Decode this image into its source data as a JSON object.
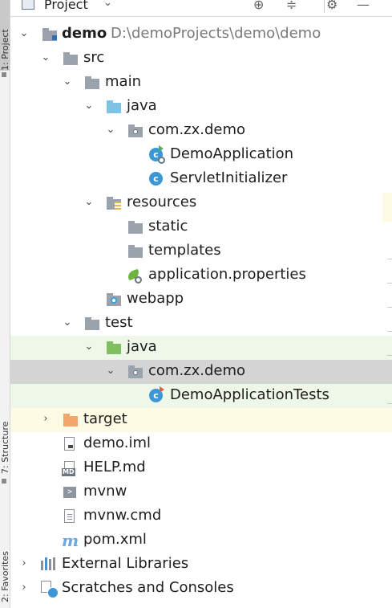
{
  "tool_strip": {
    "project_label": "1: Project",
    "structure_label": "7: Structure",
    "favorites_label": "2: Favorites"
  },
  "header": {
    "title": "Project",
    "dropdown_glyph": "▼",
    "icons": [
      "target-icon",
      "collapse-all-icon",
      "settings-icon",
      "hide-icon"
    ]
  },
  "tree": {
    "root_name": "demo",
    "root_path": "D:\\demoProjects\\demo\\demo",
    "src": "src",
    "main": "main",
    "main_java": "java",
    "main_package": "com.zx.demo",
    "demo_application": "DemoApplication",
    "servlet_initializer": "ServletInitializer",
    "resources": "resources",
    "static": "static",
    "templates": "templates",
    "application_properties": "application.properties",
    "webapp": "webapp",
    "test": "test",
    "test_java": "java",
    "test_package": "com.zx.demo",
    "demo_application_tests": "DemoApplicationTests",
    "target": "target",
    "demo_iml": "demo.iml",
    "help_md": "HELP.md",
    "mvnw": "mvnw",
    "mvnw_cmd": "mvnw.cmd",
    "pom_xml": "pom.xml",
    "external_libraries": "External Libraries",
    "scratches": "Scratches and Consoles"
  },
  "glyphs": {
    "expanded": "⌄",
    "collapsed": "›",
    "class_letter": "c",
    "md_tag": "MD",
    "terminal": ">",
    "maven": "m"
  },
  "colors": {
    "test_highlight": "#eef7e8",
    "selected_row": "#d4d4d4",
    "excluded_highlight": "#fdfbe4",
    "source_folder": "#7cc3e6",
    "test_folder": "#7fbf5f",
    "excluded_folder": "#f3a56b",
    "class_icon": "#3a98d6"
  }
}
